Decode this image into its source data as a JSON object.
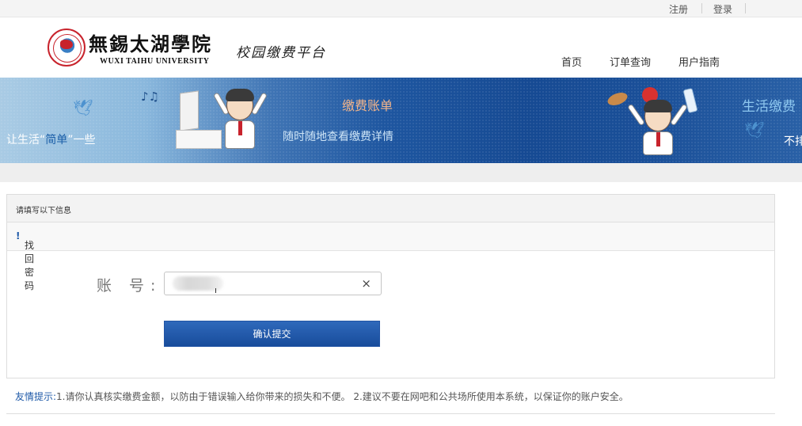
{
  "topbar": {
    "register_label": "注册",
    "login_label": "登录"
  },
  "header": {
    "logo_cn": "無錫太湖學院",
    "logo_en": "WUXI TAIHU UNIVERSITY",
    "platform_name": "校园缴费平台",
    "nav": [
      {
        "label": "首页"
      },
      {
        "label": "订单查询"
      },
      {
        "label": "用户指南"
      }
    ]
  },
  "banner": {
    "slogan_prefix": "让生活“",
    "slogan_highlight": "简单",
    "slogan_suffix": "”一些",
    "bill_title": "缴费账单",
    "bill_subtitle": "随时随地查看缴费详情",
    "life_title": "生活缴费",
    "life_cut_text": "不排"
  },
  "form": {
    "panel_title": "请填写以下信息",
    "section_title": "找回密码",
    "section_mark": "!",
    "account_label": "账 号:",
    "account_value": "",
    "clear_glyph": "×",
    "submit_label": "确认提交"
  },
  "tips": {
    "label": "友情提示:",
    "text": "1.请你认真核实缴费金额，以防由于错误输入给你带来的损失和不便。   2.建议不要在网吧和公共场所使用本系统，以保证你的账户安全。"
  },
  "icons": {
    "bird": "bird-icon",
    "note": "music-note-icon",
    "clear": "close-icon"
  },
  "colors": {
    "primary_blue": "#1f5aa8",
    "banner_dark": "#164a93",
    "accent_orange": "#f2b48a",
    "brand_red": "#c8232c"
  }
}
